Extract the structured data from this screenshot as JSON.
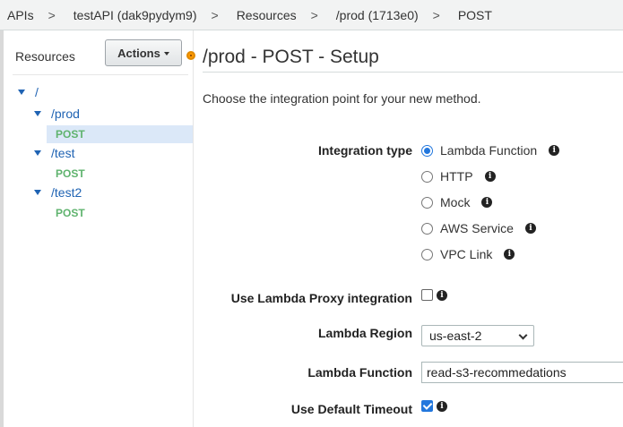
{
  "breadcrumb": [
    "APIs",
    "testAPI (dak9pydym9)",
    "Resources",
    "/prod (1713e0)",
    "POST"
  ],
  "breadcrumb_separator": ">",
  "resources_panel": {
    "title": "Resources",
    "actions_label": "Actions",
    "tree": [
      {
        "path": "/",
        "methods": []
      },
      {
        "path": "/prod",
        "methods": [
          "POST"
        ]
      },
      {
        "path": "/test",
        "methods": [
          "POST"
        ]
      },
      {
        "path": "/test2",
        "methods": [
          "POST"
        ]
      }
    ],
    "selected": "/prod POST"
  },
  "main": {
    "title": "/prod - POST - Setup",
    "intro": "Choose the integration point for your new method.",
    "integration_type": {
      "label": "Integration type",
      "options": [
        "Lambda Function",
        "HTTP",
        "Mock",
        "AWS Service",
        "VPC Link"
      ],
      "selected": "Lambda Function"
    },
    "lambda_proxy": {
      "label": "Use Lambda Proxy integration",
      "checked": false
    },
    "lambda_region": {
      "label": "Lambda Region",
      "value": "us-east-2"
    },
    "lambda_function": {
      "label": "Lambda Function",
      "value": "read-s3-recommedations"
    },
    "default_timeout": {
      "label": "Use Default Timeout",
      "checked": true
    }
  },
  "colors": {
    "accent_blue": "#2277dd",
    "link_blue": "#1f63b3",
    "method_green": "#5fb36e",
    "selection_bg": "#dbe8f8",
    "orange": "#ff9900"
  },
  "icons": {
    "info": "info-circle-icon",
    "tree_toggle": "triangle-down-icon",
    "select": "chevron-down-icon",
    "status": "orange-dot-icon"
  }
}
